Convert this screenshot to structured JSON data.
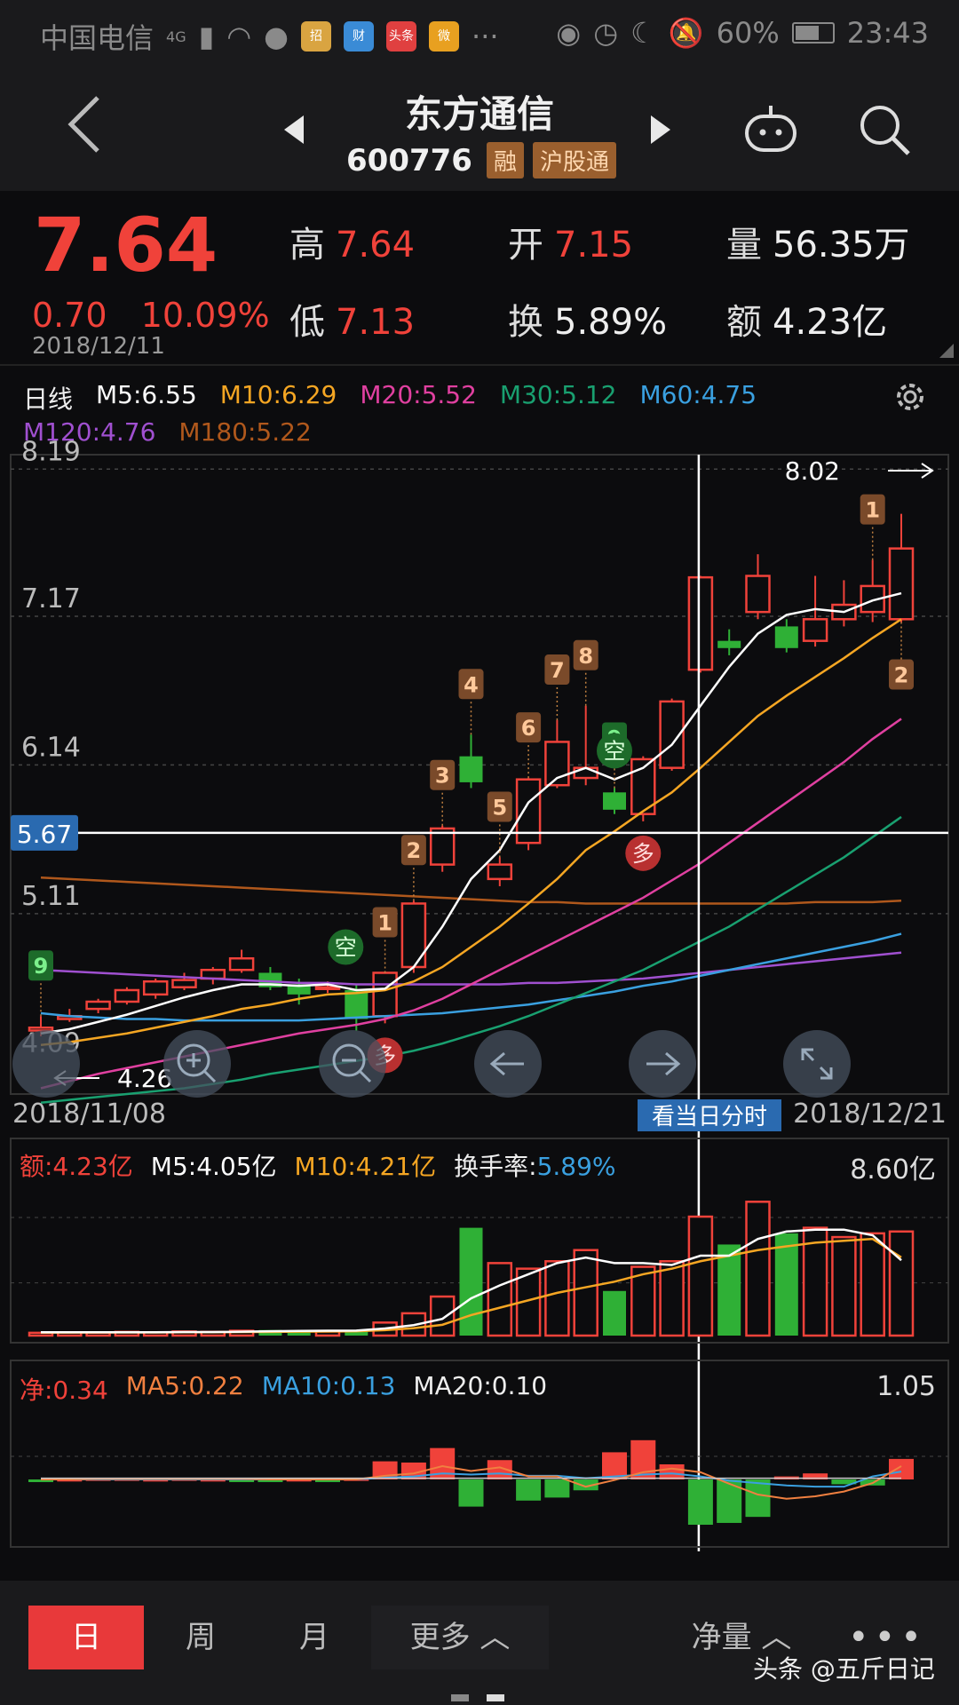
{
  "status": {
    "carrier": "中国电信",
    "network": "4G",
    "battery": "60%",
    "time": "23:43",
    "apps": [
      "招",
      "财",
      "头条",
      "微"
    ]
  },
  "nav": {
    "title": "东方通信",
    "code": "600776",
    "tags": [
      "融",
      "沪股通"
    ]
  },
  "quote": {
    "price": "7.64",
    "change": "0.70",
    "change_pct": "10.09%",
    "date": "2018/12/11",
    "high_label": "高",
    "high": "7.64",
    "low_label": "低",
    "low": "7.13",
    "open_label": "开",
    "open": "7.15",
    "turnover_label": "换",
    "turnover": "5.89%",
    "volume_label": "量",
    "volume": "56.35万",
    "amount_label": "额",
    "amount": "4.23亿"
  },
  "kline_legend": {
    "period": "日线",
    "m5": "M5:6.55",
    "m10": "M10:6.29",
    "m20": "M20:5.52",
    "m30": "M30:5.12",
    "m60": "M60:4.75",
    "m120": "M120:4.76",
    "m180": "M180:5.22"
  },
  "kline_axis": {
    "y_labels": [
      "8.19",
      "7.17",
      "6.14",
      "5.11",
      "4.09"
    ],
    "cross_price": "5.67",
    "max_label": "8.02",
    "min_label": "4.26",
    "start_date": "2018/11/08",
    "end_date": "2018/12/21",
    "intraday_btn": "看当日分时"
  },
  "volume_legend": {
    "amount": "额:4.23亿",
    "m5": "M5:4.05亿",
    "m10": "M10:4.21亿",
    "turnover_label": "换手率:",
    "turnover": "5.89%",
    "max": "8.60亿"
  },
  "net_legend": {
    "net": "净:0.34",
    "ma5": "MA5:0.22",
    "ma10": "MA10:0.13",
    "ma20": "MA20:0.10",
    "max": "1.05"
  },
  "tabs": {
    "day": "日",
    "week": "周",
    "month": "月",
    "more": "更多 ︿",
    "net": "净量 ︿"
  },
  "watermark": "头条 @五斤日记",
  "colors": {
    "up": "#f0423a",
    "down": "#2fb036",
    "m5": "#ffffff",
    "m10": "#f5a623",
    "m20": "#e040a0",
    "m30": "#19a070",
    "m60": "#3aa0e0",
    "m120": "#a050d0",
    "m180": "#b0581c"
  },
  "chart_data": {
    "type": "candlestick",
    "candles": [
      {
        "o": 4.3,
        "h": 4.4,
        "l": 4.26,
        "c": 4.32
      },
      {
        "o": 4.38,
        "h": 4.45,
        "l": 4.36,
        "c": 4.4
      },
      {
        "o": 4.45,
        "h": 4.52,
        "l": 4.42,
        "c": 4.5
      },
      {
        "o": 4.5,
        "h": 4.6,
        "l": 4.48,
        "c": 4.58
      },
      {
        "o": 4.55,
        "h": 4.66,
        "l": 4.52,
        "c": 4.64
      },
      {
        "o": 4.6,
        "h": 4.7,
        "l": 4.58,
        "c": 4.65
      },
      {
        "o": 4.66,
        "h": 4.74,
        "l": 4.62,
        "c": 4.72
      },
      {
        "o": 4.72,
        "h": 4.86,
        "l": 4.7,
        "c": 4.8
      },
      {
        "o": 4.7,
        "h": 4.74,
        "l": 4.58,
        "c": 4.6
      },
      {
        "o": 4.62,
        "h": 4.66,
        "l": 4.48,
        "c": 4.55
      },
      {
        "o": 4.6,
        "h": 4.64,
        "l": 4.56,
        "c": 4.6
      },
      {
        "o": 4.58,
        "h": 4.62,
        "l": 4.3,
        "c": 4.38
      },
      {
        "o": 4.4,
        "h": 4.7,
        "l": 4.35,
        "c": 4.7
      },
      {
        "o": 4.74,
        "h": 5.2,
        "l": 4.7,
        "c": 5.18
      },
      {
        "o": 5.45,
        "h": 5.72,
        "l": 5.4,
        "c": 5.7
      },
      {
        "o": 6.2,
        "h": 6.35,
        "l": 5.98,
        "c": 6.02
      },
      {
        "o": 5.35,
        "h": 5.5,
        "l": 5.3,
        "c": 5.45
      },
      {
        "o": 5.6,
        "h": 6.05,
        "l": 5.55,
        "c": 6.04
      },
      {
        "o": 6.0,
        "h": 6.45,
        "l": 5.98,
        "c": 6.3
      },
      {
        "o": 6.05,
        "h": 6.55,
        "l": 6.0,
        "c": 6.12
      },
      {
        "o": 5.95,
        "h": 5.98,
        "l": 5.8,
        "c": 5.83
      },
      {
        "o": 5.8,
        "h": 6.2,
        "l": 5.75,
        "c": 6.18
      },
      {
        "o": 6.12,
        "h": 6.6,
        "l": 6.1,
        "c": 6.58
      },
      {
        "o": 6.8,
        "h": 7.45,
        "l": 6.78,
        "c": 7.44
      },
      {
        "o": 7.0,
        "h": 7.08,
        "l": 6.9,
        "c": 6.95
      },
      {
        "o": 7.2,
        "h": 7.6,
        "l": 7.15,
        "c": 7.45
      },
      {
        "o": 7.1,
        "h": 7.15,
        "l": 6.92,
        "c": 6.95
      },
      {
        "o": 7.0,
        "h": 7.45,
        "l": 6.96,
        "c": 7.15
      },
      {
        "o": 7.15,
        "h": 7.42,
        "l": 7.1,
        "c": 7.25
      },
      {
        "o": 7.2,
        "h": 7.56,
        "l": 7.13,
        "c": 7.38
      },
      {
        "o": 7.15,
        "h": 7.88,
        "l": 7.13,
        "c": 7.64
      }
    ],
    "ma5": [
      4.28,
      4.31,
      4.36,
      4.41,
      4.47,
      4.53,
      4.58,
      4.62,
      4.62,
      4.61,
      4.62,
      4.58,
      4.59,
      4.74,
      5.02,
      5.35,
      5.55,
      5.88,
      6.05,
      6.12,
      6.04,
      6.12,
      6.28,
      6.55,
      6.82,
      7.05,
      7.18,
      7.22,
      7.2,
      7.28,
      7.33
    ],
    "ma10": [
      4.2,
      4.22,
      4.25,
      4.28,
      4.32,
      4.36,
      4.4,
      4.45,
      4.48,
      4.52,
      4.55,
      4.56,
      4.58,
      4.64,
      4.74,
      4.88,
      5.02,
      5.18,
      5.35,
      5.55,
      5.68,
      5.82,
      5.95,
      6.12,
      6.3,
      6.48,
      6.62,
      6.75,
      6.88,
      7.02,
      7.15
    ],
    "ma20": [
      3.9,
      3.95,
      4.0,
      4.04,
      4.08,
      4.12,
      4.16,
      4.2,
      4.24,
      4.28,
      4.31,
      4.34,
      4.38,
      4.44,
      4.52,
      4.62,
      4.72,
      4.82,
      4.92,
      5.02,
      5.12,
      5.22,
      5.34,
      5.46,
      5.6,
      5.74,
      5.88,
      6.02,
      6.16,
      6.32,
      6.46
    ],
    "ma30": [
      3.8,
      3.82,
      3.84,
      3.86,
      3.88,
      3.9,
      3.93,
      3.96,
      4.0,
      4.03,
      4.06,
      4.09,
      4.12,
      4.16,
      4.21,
      4.27,
      4.33,
      4.4,
      4.48,
      4.56,
      4.64,
      4.72,
      4.82,
      4.92,
      5.02,
      5.14,
      5.26,
      5.38,
      5.5,
      5.64,
      5.78
    ],
    "ma60": [
      4.42,
      4.4,
      4.39,
      4.38,
      4.38,
      4.37,
      4.37,
      4.37,
      4.37,
      4.37,
      4.38,
      4.39,
      4.4,
      4.41,
      4.42,
      4.44,
      4.46,
      4.48,
      4.51,
      4.54,
      4.57,
      4.61,
      4.64,
      4.68,
      4.72,
      4.76,
      4.8,
      4.84,
      4.88,
      4.92,
      4.97
    ],
    "ma120": [
      4.72,
      4.71,
      4.7,
      4.69,
      4.68,
      4.67,
      4.66,
      4.65,
      4.64,
      4.63,
      4.63,
      4.62,
      4.62,
      4.62,
      4.62,
      4.62,
      4.62,
      4.63,
      4.63,
      4.64,
      4.65,
      4.66,
      4.68,
      4.7,
      4.72,
      4.74,
      4.76,
      4.78,
      4.8,
      4.82,
      4.84
    ],
    "ma180": [
      5.36,
      5.35,
      5.34,
      5.33,
      5.32,
      5.31,
      5.3,
      5.29,
      5.28,
      5.27,
      5.26,
      5.25,
      5.24,
      5.23,
      5.22,
      5.21,
      5.2,
      5.19,
      5.19,
      5.18,
      5.18,
      5.18,
      5.18,
      5.18,
      5.18,
      5.18,
      5.18,
      5.19,
      5.19,
      5.19,
      5.2
    ],
    "markers": [
      {
        "i": 0,
        "label": "9",
        "kind": "g"
      },
      {
        "i": 12,
        "label": "1",
        "kind": "o"
      },
      {
        "i": 13,
        "label": "2",
        "kind": "o"
      },
      {
        "i": 14,
        "label": "3",
        "kind": "o"
      },
      {
        "i": 15,
        "label": "4",
        "kind": "o"
      },
      {
        "i": 16,
        "label": "5",
        "kind": "o"
      },
      {
        "i": 17,
        "label": "6",
        "kind": "o"
      },
      {
        "i": 18,
        "label": "7",
        "kind": "o"
      },
      {
        "i": 19,
        "label": "8",
        "kind": "o"
      },
      {
        "i": 20,
        "label": "9",
        "kind": "g"
      },
      {
        "i": 29,
        "label": "1",
        "kind": "o"
      },
      {
        "i": 30,
        "label": "2",
        "kind": "o"
      }
    ],
    "circles": [
      {
        "i": 11,
        "label": "空",
        "kind": "g",
        "pos": "top"
      },
      {
        "i": 12,
        "label": "多",
        "kind": "r",
        "pos": "bottom"
      },
      {
        "i": 20,
        "label": "空",
        "kind": "g",
        "pos": "top"
      },
      {
        "i": 21,
        "label": "多",
        "kind": "r",
        "pos": "bottom"
      }
    ],
    "volume": [
      0.15,
      0.18,
      0.16,
      0.2,
      0.18,
      0.22,
      0.2,
      0.26,
      0.3,
      0.26,
      0.22,
      0.3,
      0.7,
      1.2,
      2.1,
      5.8,
      3.9,
      3.6,
      4.0,
      4.6,
      2.4,
      3.7,
      4.0,
      6.4,
      4.9,
      7.2,
      5.5,
      5.8,
      5.3,
      5.5,
      5.6
    ],
    "vol_ma5": [
      0.18,
      0.18,
      0.18,
      0.18,
      0.18,
      0.19,
      0.19,
      0.21,
      0.23,
      0.25,
      0.26,
      0.27,
      0.38,
      0.56,
      0.9,
      2.0,
      2.7,
      3.3,
      3.9,
      4.2,
      3.9,
      3.9,
      3.8,
      4.3,
      4.3,
      5.2,
      5.6,
      5.7,
      5.7,
      5.4,
      4.05
    ],
    "vol_ma10": [
      0.16,
      0.16,
      0.17,
      0.17,
      0.17,
      0.18,
      0.18,
      0.19,
      0.2,
      0.21,
      0.22,
      0.23,
      0.29,
      0.4,
      0.58,
      1.1,
      1.5,
      1.9,
      2.3,
      2.6,
      2.9,
      3.3,
      3.6,
      4.0,
      4.3,
      4.6,
      4.8,
      5.0,
      5.1,
      5.2,
      4.21
    ],
    "net": [
      -0.02,
      0.01,
      0.02,
      0.02,
      0.01,
      0.02,
      0.01,
      -0.02,
      -0.02,
      0.01,
      -0.02,
      0.02,
      0.3,
      0.28,
      0.52,
      -0.45,
      0.32,
      -0.35,
      -0.3,
      -0.18,
      0.45,
      0.65,
      0.25,
      -0.75,
      -0.72,
      -0.62,
      0.05,
      0.1,
      -0.08,
      -0.1,
      0.34
    ],
    "net_ma5": [
      0.0,
      0.0,
      0.01,
      0.01,
      0.01,
      0.01,
      0.01,
      0.01,
      0.0,
      0.0,
      0.0,
      0.0,
      0.06,
      0.1,
      0.22,
      0.14,
      0.2,
      0.05,
      0.05,
      -0.12,
      -0.01,
      0.12,
      0.18,
      0.12,
      -0.07,
      -0.25,
      -0.32,
      -0.28,
      -0.2,
      -0.06,
      0.22
    ],
    "net_ma10": [
      0.0,
      0.0,
      0.0,
      0.0,
      0.0,
      0.0,
      0.0,
      0.0,
      0.0,
      0.0,
      0.0,
      0.0,
      0.03,
      0.05,
      0.1,
      0.08,
      0.1,
      0.06,
      0.06,
      0.02,
      0.05,
      0.08,
      0.1,
      0.05,
      -0.02,
      -0.06,
      -0.1,
      -0.12,
      -0.12,
      0.05,
      0.13
    ],
    "cross_index": 23
  }
}
